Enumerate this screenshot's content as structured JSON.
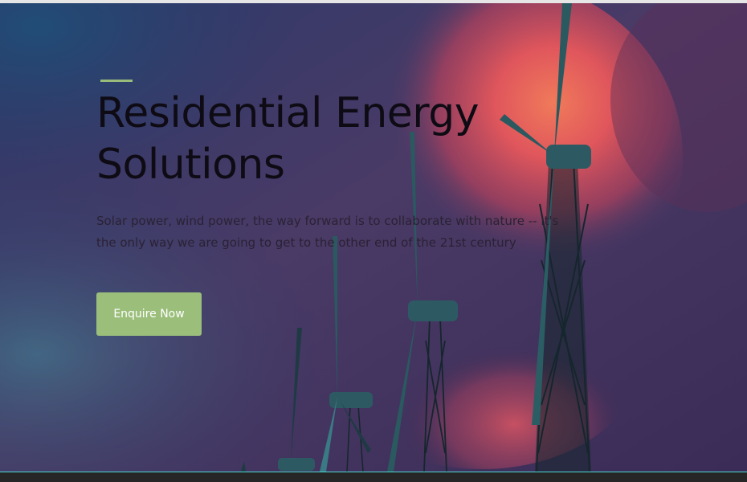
{
  "hero": {
    "title": "Residential Energy Solutions",
    "subtitle": "Solar power, wind power, the way forward is to collaborate with nature -- it's the only way we are going to get to the other end of the 21st century",
    "cta_label": "Enquire Now",
    "background": "Stormy purple sky with a glowing red-orange cloud and silhouetted wind turbines"
  },
  "colors": {
    "accent": "#9bbf7b",
    "title_text": "#0e0b14",
    "body_text": "#2a2234",
    "bottom_line": "#4fd6d6",
    "bottom_bar": "#262626"
  },
  "icons": [
    "wind-turbine-icon"
  ]
}
